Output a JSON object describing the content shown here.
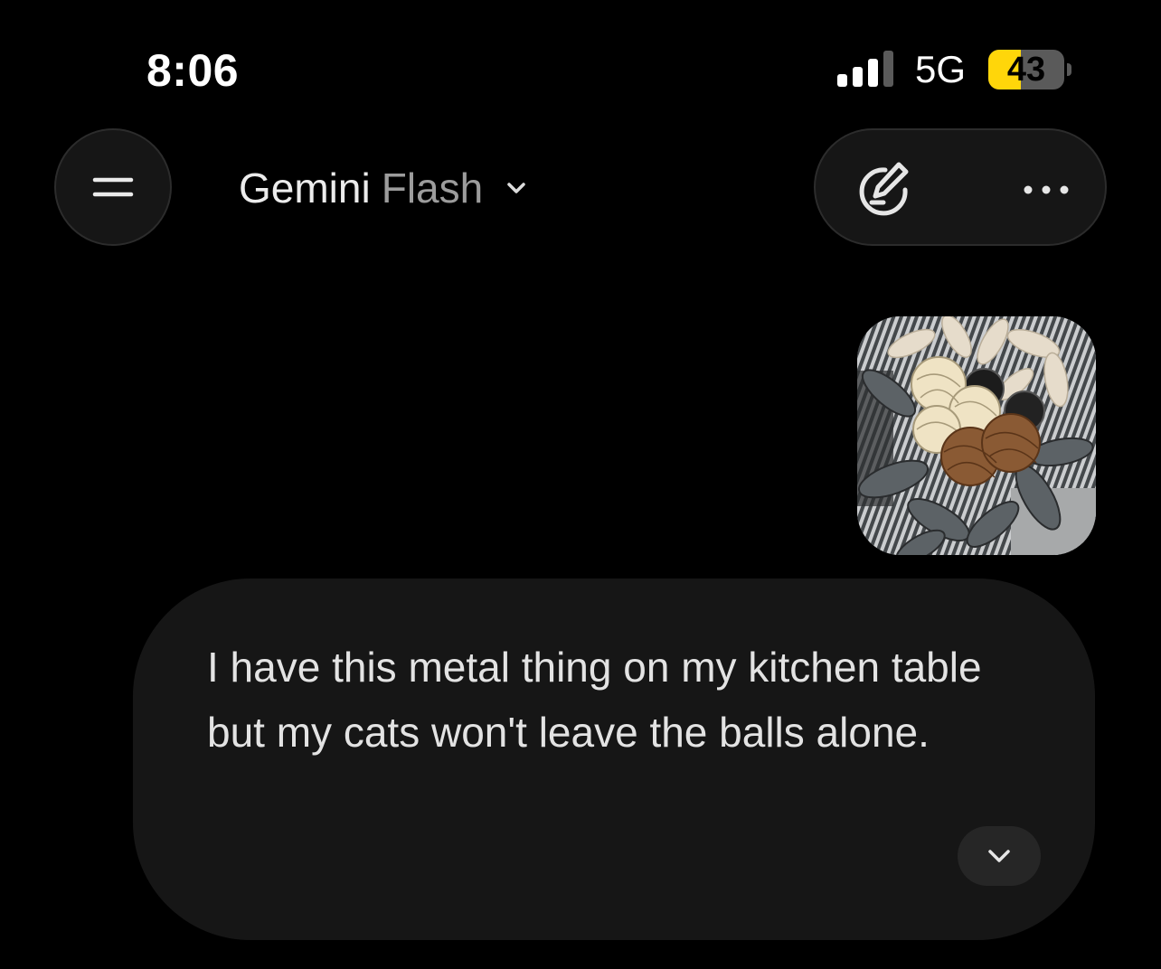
{
  "status_bar": {
    "time": "8:06",
    "network": "5G",
    "battery_level": "43",
    "battery_fraction": 0.43,
    "signal_bars_active": 3,
    "signal_bars_total": 4
  },
  "header": {
    "model_name": "Gemini",
    "model_variant": "Flash",
    "icons": {
      "menu": "menu-icon",
      "chevron": "chevron-down-icon",
      "edit": "new-chat-edit-icon",
      "more": "more-horizontal-icon"
    }
  },
  "message": {
    "attachment": "image-thumbnail",
    "text": "I have this metal thing on my kitchen table but my cats won't leave the balls alone.",
    "expand_icon": "chevron-down-icon"
  },
  "colors": {
    "background": "#000000",
    "surface": "#161616",
    "battery": "#ffd60a",
    "text_primary": "#e3e3e3",
    "text_muted": "#9c9c9c"
  }
}
